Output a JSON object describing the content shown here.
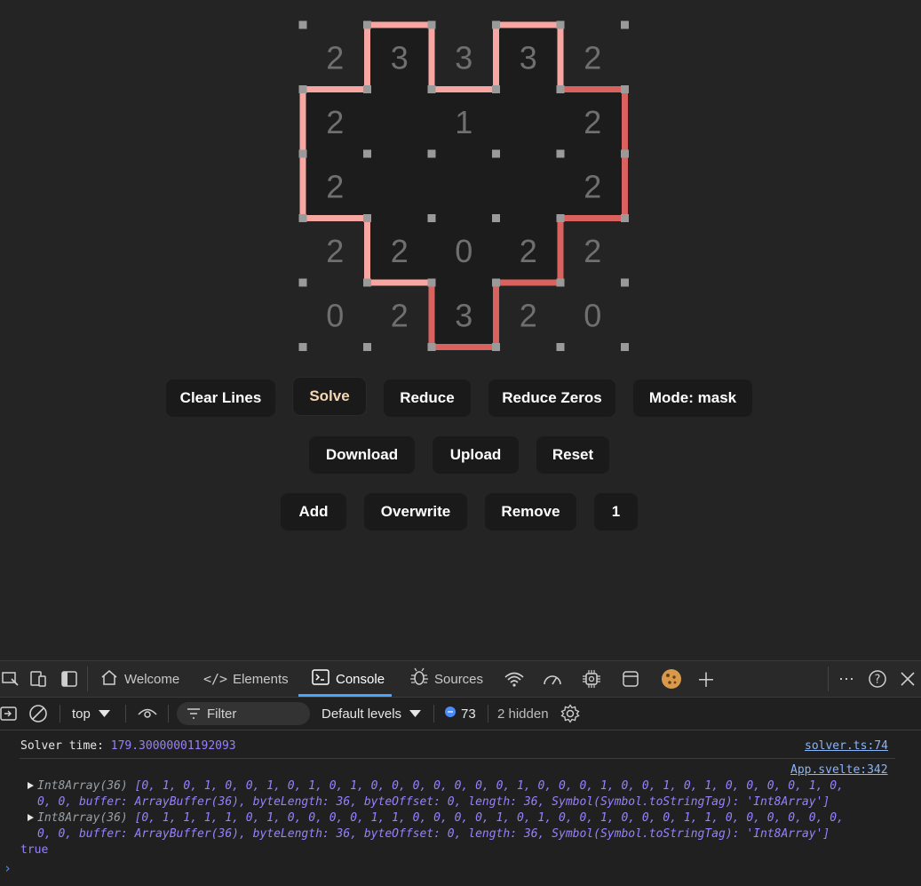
{
  "puzzle": {
    "clues": [
      [
        "2",
        "3",
        "3",
        "3",
        "2"
      ],
      [
        "2",
        "",
        "1",
        "",
        "2"
      ],
      [
        "2",
        "",
        "",
        "",
        "2"
      ],
      [
        "2",
        "2",
        "0",
        "2",
        "2"
      ],
      [
        "0",
        "2",
        "3",
        "2",
        "0"
      ]
    ],
    "colors": {
      "background": "#242424",
      "dot": "#9a9a9a",
      "clue": "#6f6f6f",
      "line_light": "#f7a6a2",
      "line_dark": "#d9625f",
      "inner": "#1c1c1c"
    }
  },
  "buttons": {
    "row1": [
      "Clear Lines",
      "Solve",
      "Reduce",
      "Reduce Zeros",
      "Mode: mask"
    ],
    "row2": [
      "Download",
      "Upload",
      "Reset"
    ],
    "row3": [
      "Add",
      "Overwrite",
      "Remove",
      "1"
    ]
  },
  "devtools": {
    "tabs": [
      "Welcome",
      "Elements",
      "Console",
      "Sources"
    ],
    "active_tab": "Console",
    "toolbar": {
      "context": "top",
      "filter_placeholder": "Filter",
      "levels": "Default levels",
      "message_count": "73",
      "hidden": "2 hidden"
    },
    "console": {
      "line1_label": "Solver time:",
      "line1_value": "179.30000001192093",
      "line1_source": "solver.ts:74",
      "group_source": "App.svelte:342",
      "array_type": "Int8Array(36)",
      "array1_values": "[0, 1, 0, 1, 0, 0, 1, 0, 1, 0, 1, 0, 0, 0, 0, 0, 0, 0, 1, 0, 0, 0, 1, 0, 0, 1, 0, 1, 0, 0, 0, 0, 1, 0,",
      "array2_values": "[0, 1, 1, 1, 1, 0, 1, 0, 0, 0, 0, 1, 1, 0, 0, 0, 0, 1, 0, 1, 0, 0, 1, 0, 0, 0, 1, 1, 0, 0, 0, 0, 0, 0,",
      "array_tail": "0, 0, buffer: ArrayBuffer(36), byteLength: 36, byteOffset: 0, length: 36, Symbol(Symbol.toStringTag): 'Int8Array']",
      "result": "true",
      "prompt": "›"
    }
  }
}
